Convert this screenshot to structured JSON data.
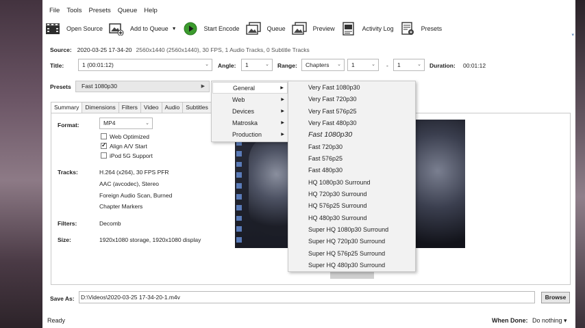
{
  "menubar": [
    "File",
    "Tools",
    "Presets",
    "Queue",
    "Help"
  ],
  "toolbar": {
    "open_source": "Open Source",
    "add_to_queue": "Add to Queue",
    "start_encode": "Start Encode",
    "queue": "Queue",
    "preview": "Preview",
    "activity_log": "Activity Log",
    "presets": "Presets"
  },
  "source": {
    "label": "Source:",
    "name": "2020-03-25 17-34-20",
    "info": "2560x1440 (2560x1440), 30 FPS, 1 Audio Tracks, 0 Subtitle Tracks"
  },
  "title_row": {
    "title_label": "Title:",
    "title_value": "1 (00:01:12)",
    "angle_label": "Angle:",
    "angle_value": "1",
    "range_label": "Range:",
    "range_type": "Chapters",
    "range_start": "1",
    "dash": "-",
    "range_end": "1",
    "duration_label": "Duration:",
    "duration_value": "00:01:12"
  },
  "presets_row": {
    "label": "Presets",
    "value": "Fast 1080p30"
  },
  "tabs": [
    "Summary",
    "Dimensions",
    "Filters",
    "Video",
    "Audio",
    "Subtitles"
  ],
  "summary": {
    "format_label": "Format:",
    "format_value": "MP4",
    "web_optimized": "Web Optimized",
    "align_av": "Align A/V Start",
    "ipod": "iPod 5G Support",
    "tracks_label": "Tracks:",
    "tracks": [
      "H.264 (x264), 30 FPS PFR",
      "AAC (avcodec), Stereo",
      "Foreign Audio Scan, Burned",
      "Chapter Markers"
    ],
    "filters_label": "Filters:",
    "filters_value": "Decomb",
    "size_label": "Size:",
    "size_value": "1920x1080 storage, 1920x1080 display",
    "checks": {
      "web_optimized": false,
      "align_av": true,
      "ipod": false
    }
  },
  "save": {
    "label": "Save As:",
    "path": "D:\\Videos\\2020-03-25 17-34-20-1.m4v",
    "browse": "Browse"
  },
  "status": {
    "text": "Ready",
    "when_done_label": "When Done:",
    "when_done_value": "Do nothing ▾"
  },
  "menu_categories": [
    "General",
    "Web",
    "Devices",
    "Matroska",
    "Production"
  ],
  "menu_general": [
    "Very Fast 1080p30",
    "Very Fast 720p30",
    "Very Fast 576p25",
    "Very Fast 480p30",
    "Fast 1080p30",
    "Fast 720p30",
    "Fast 576p25",
    "Fast 480p30",
    "HQ 1080p30 Surround",
    "HQ 720p30 Surround",
    "HQ 576p25 Surround",
    "HQ 480p30 Surround",
    "Super HQ 1080p30 Surround",
    "Super HQ 720p30 Surround",
    "Super HQ 576p25 Surround",
    "Super HQ 480p30 Surround"
  ],
  "colors": {
    "play_green": "#3c9b2e",
    "accent_blue": "#2a5fa8"
  }
}
